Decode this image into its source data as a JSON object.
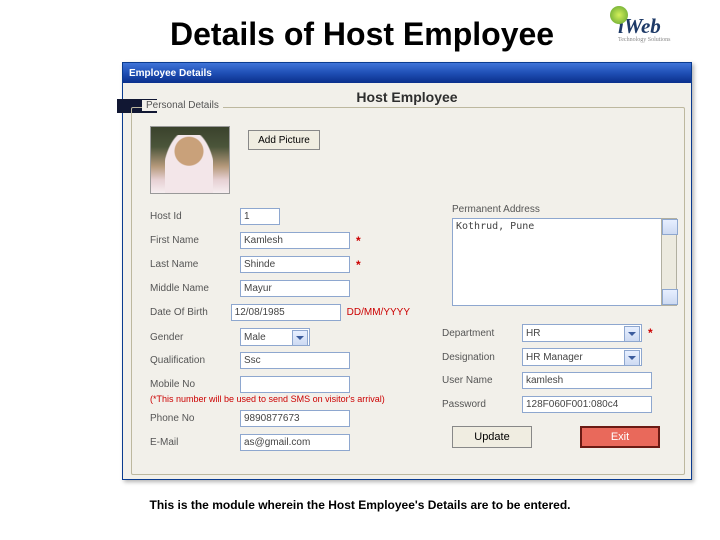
{
  "slide": {
    "title": "Details of Host Employee",
    "caption": "This is the module wherein the Host Employee's Details are to be entered."
  },
  "logo": {
    "text": "iWeb",
    "sub": "Technology Solutions"
  },
  "window": {
    "title": "Employee Details",
    "heading": "Host Employee",
    "group_legend": "Personal Details"
  },
  "buttons": {
    "add_picture": "Add Picture",
    "update": "Update",
    "exit": "Exit"
  },
  "labels": {
    "host_id": "Host Id",
    "first_name": "First Name",
    "last_name": "Last Name",
    "middle_name": "Middle Name",
    "dob": "Date Of Birth",
    "gender": "Gender",
    "qualification": "Qualification",
    "mobile": "Mobile No",
    "phone": "Phone No",
    "email": "E-Mail",
    "perm_addr": "Permanent Address",
    "department": "Department",
    "designation": "Designation",
    "username": "User Name",
    "password": "Password"
  },
  "values": {
    "host_id": "1",
    "first_name": "Kamlesh",
    "last_name": "Shinde",
    "middle_name": "Mayur",
    "dob": "12/08/1985",
    "gender": "Male",
    "qualification": "Ssc",
    "mobile": "",
    "phone": "9890877673",
    "email": "as@gmail.com",
    "perm_addr": "Kothrud, Pune",
    "department": "HR",
    "designation": "HR Manager",
    "username": "kamlesh",
    "password": "128F060F001:080c4"
  },
  "hints": {
    "date_format": "DD/MM/YYYY",
    "mobile_note": "(*This number will be used to send SMS on visitor's arrival)"
  },
  "marks": {
    "required": "*"
  }
}
